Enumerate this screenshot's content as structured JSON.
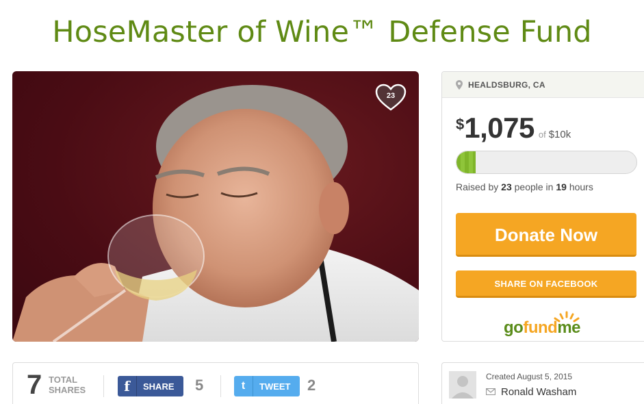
{
  "page_title": "HoseMaster of Wine™ Defense Fund",
  "hero": {
    "heart_count": "23"
  },
  "campaign": {
    "location": "HEALDSBURG, CA",
    "currency_symbol": "$",
    "amount_raised": "1,075",
    "of_label": "of",
    "goal": "$10k",
    "progress_fraction": 0.1075,
    "raised_prefix": "Raised by",
    "donor_count": "23",
    "people_in": "people in",
    "hours_count": "19",
    "hours_label": "hours",
    "donate_label": "Donate Now",
    "share_facebook_label": "SHARE ON FACEBOOK",
    "logo_go": "go",
    "logo_fund": "fund",
    "logo_me": "me"
  },
  "shares": {
    "total": "7",
    "total_label_line1": "TOTAL",
    "total_label_line2": "SHARES",
    "facebook_label": "SHARE",
    "facebook_count": "5",
    "twitter_label": "TWEET",
    "twitter_count": "2"
  },
  "organizer": {
    "created": "Created August 5, 2015",
    "name": "Ronald Washam"
  },
  "colors": {
    "title_green": "#5f8a14",
    "donate_orange": "#f5a623",
    "progress_green": "#7fb52a",
    "facebook_blue": "#3b5998",
    "twitter_blue": "#55acee"
  }
}
